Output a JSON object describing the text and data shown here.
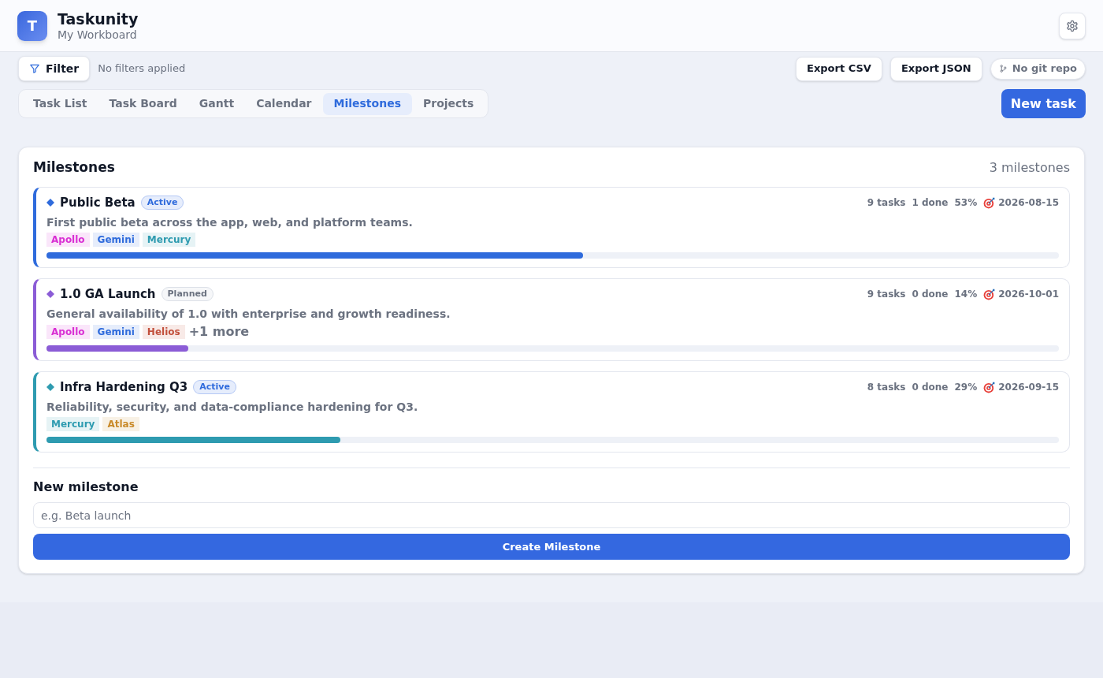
{
  "header": {
    "logo_letter": "T",
    "title": "Taskunity",
    "subtitle": "My Workboard"
  },
  "toolbar": {
    "filter_button": "Filter",
    "filter_status": "No filters applied",
    "actions": [
      "Export CSV",
      "Export JSON"
    ],
    "git_status": "No git repo"
  },
  "tabs": [
    {
      "label": "Task List",
      "selected": false
    },
    {
      "label": "Task Board",
      "selected": false
    },
    {
      "label": "Gantt",
      "selected": false
    },
    {
      "label": "Calendar",
      "selected": false
    },
    {
      "label": "Milestones",
      "selected": true
    },
    {
      "label": "Projects",
      "selected": false
    }
  ],
  "new_task_button": "New task",
  "milestones_panel": {
    "title": "Milestones",
    "count": "3 milestones",
    "milestones": [
      {
        "title": "Public Beta",
        "color": "#2f6bdc",
        "status": {
          "label": "Active",
          "kind": "active"
        },
        "tasks": "9 tasks",
        "done": "1 done",
        "percent": "53%",
        "due": "2026-08-15",
        "description": "First public beta across the app, web, and platform teams.",
        "tags": [
          {
            "label": "Apollo",
            "color": "#d92fd3"
          },
          {
            "label": "Gemini",
            "color": "#2f6bdc"
          },
          {
            "label": "Mercury",
            "color": "#2e9bb0"
          }
        ],
        "level": 0.53
      },
      {
        "title": "1.0 GA Launch",
        "color": "#8b5cd6",
        "status": {
          "label": "Planned",
          "kind": "planned"
        },
        "tasks": "9 tasks",
        "done": "0 done",
        "percent": "14%",
        "due": "2026-10-01",
        "description": "General availability of 1.0 with enterprise and growth readiness.",
        "tags": [
          {
            "label": "Apollo",
            "color": "#d92fd3"
          },
          {
            "label": "Gemini",
            "color": "#2f6bdc"
          },
          {
            "label": "Helios",
            "color": "#c2503c"
          }
        ],
        "more": "+1 more",
        "level": 0.14
      },
      {
        "title": "Infra Hardening Q3",
        "color": "#2e9bb0",
        "status": {
          "label": "Active",
          "kind": "active"
        },
        "tasks": "8 tasks",
        "done": "0 done",
        "percent": "29%",
        "due": "2026-09-15",
        "description": "Reliability, security, and data-compliance hardening for Q3.",
        "tags": [
          {
            "label": "Mercury",
            "color": "#2e9bb0"
          },
          {
            "label": "Atlas",
            "color": "#c98a2a"
          }
        ],
        "level": 0.29
      }
    ]
  },
  "new_milestone": {
    "heading": "New milestone",
    "placeholder": "e.g. Beta launch",
    "button": "Create Milestone"
  }
}
